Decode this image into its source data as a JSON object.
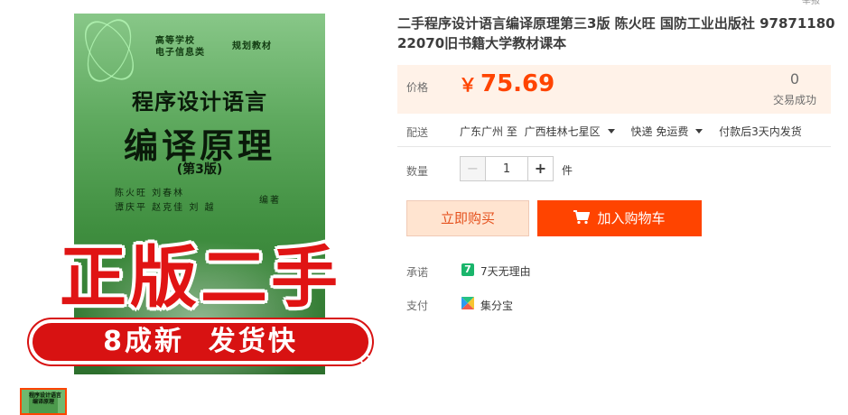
{
  "product": {
    "title": "二手程序设计语言编译原理第三3版 陈火旺 国防工业出版社 9787118022070旧书籍大学教材课本",
    "corner_text": "举报"
  },
  "gallery": {
    "cover": {
      "tag_left": "高等学校\n电子信息类",
      "tag_right": "规划教材",
      "title_line1": "程序设计语言",
      "title_line2": "编译原理",
      "edition": "(第3版)",
      "authors_line1": "陈火旺    刘春林",
      "authors_line2": "谭庆平  赵克佳  刘  越",
      "editor_mark": "编著"
    },
    "promo_text": "正版二手",
    "banner_text": "8成新  发货快",
    "thumb_text": "程序设计语言\n编译原理",
    "zoom_icon": "magnifier-icon"
  },
  "price": {
    "label": "价格",
    "currency": "￥",
    "value": "75.69",
    "sales_count": "0",
    "sales_label": "交易成功"
  },
  "shipping": {
    "label": "配送",
    "from": "广东广州 至",
    "to": "广西桂林七星区",
    "method": "快递 免运费",
    "dispatch": "付款后3天内发货"
  },
  "quantity": {
    "label": "数量",
    "value": "1",
    "minus": "−",
    "plus": "+",
    "unit": "件"
  },
  "actions": {
    "buy_now": "立即购买",
    "add_to_cart": "加入购物车"
  },
  "promise": {
    "label": "承诺",
    "icon_text": "7",
    "text": "7天无理由"
  },
  "payment": {
    "label": "支付",
    "text": "集分宝"
  },
  "colors": {
    "accent": "#ff4400",
    "price_bg": "#fff2e8",
    "promise_green": "#1ab56b"
  }
}
